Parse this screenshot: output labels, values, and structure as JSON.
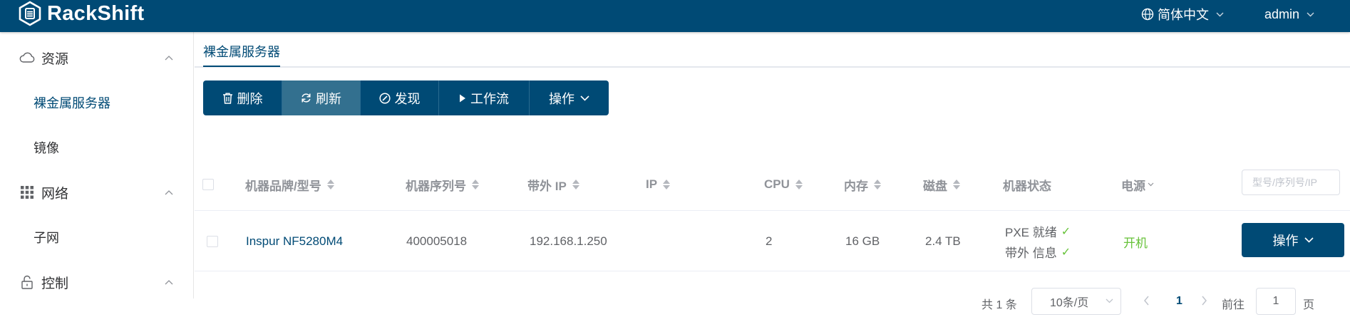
{
  "app": {
    "brand": "RackShift"
  },
  "header": {
    "language": "简体中文",
    "user": "admin"
  },
  "sidebar": {
    "groups": [
      {
        "label": "资源",
        "icon": "cloud-icon",
        "items": [
          {
            "label": "裸金属服务器",
            "active": true
          },
          {
            "label": "镜像"
          }
        ]
      },
      {
        "label": "网络",
        "icon": "grid-icon",
        "items": [
          {
            "label": "子网"
          }
        ]
      },
      {
        "label": "控制",
        "icon": "lock-icon",
        "items": []
      }
    ]
  },
  "tabs": [
    {
      "label": "裸金属服务器",
      "active": true
    }
  ],
  "toolbar": {
    "delete": "删除",
    "refresh": "刷新",
    "discover": "发现",
    "workflow": "工作流",
    "actions": "操作"
  },
  "table": {
    "columns": {
      "brand_model": "机器品牌/型号",
      "serial": "机器序列号",
      "oob_ip": "带外 IP",
      "ip": "IP",
      "cpu": "CPU",
      "memory": "内存",
      "disk": "磁盘",
      "status": "机器状态",
      "power": "电源"
    },
    "search_placeholder": "型号/序列号/IP",
    "rows": [
      {
        "brand_model": "Inspur NF5280M4",
        "serial": "400005018",
        "oob_ip": "192.168.1.250",
        "ip": "",
        "cpu": "2",
        "memory": "16 GB",
        "disk": "2.4 TB",
        "status_pxe": "PXE 就绪",
        "status_oob": "带外 信息",
        "power": "开机",
        "action": "操作"
      }
    ]
  },
  "pagination": {
    "total": "共 1 条",
    "page_size": "10条/页",
    "current": "1",
    "goto_label": "前往",
    "goto_value": "1",
    "page_suffix": "页"
  },
  "colors": {
    "primary": "#004a75",
    "success": "#67c23a"
  }
}
